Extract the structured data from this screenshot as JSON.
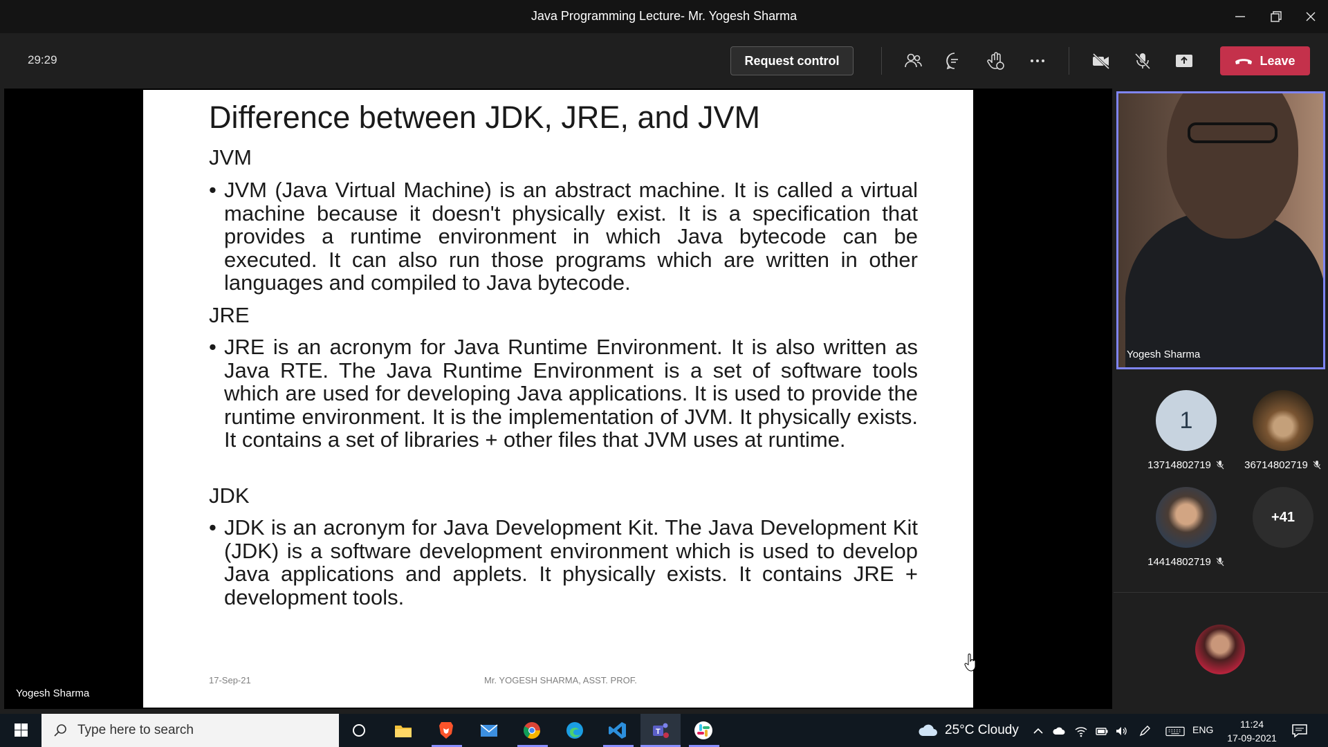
{
  "window": {
    "title": "Java Programming Lecture- Mr. Yogesh Sharma"
  },
  "toolbar": {
    "timer": "29:29",
    "request_control_label": "Request control",
    "leave_label": "Leave",
    "leave_color": "#c4314b"
  },
  "stage": {
    "presenter_name": "Yogesh Sharma"
  },
  "slide": {
    "title": "Difference between JDK, JRE, and JVM",
    "sections": [
      {
        "heading": "JVM",
        "text": "JVM (Java Virtual Machine) is an abstract machine. It is called a virtual machine because it doesn't physically exist. It is a specification that provides a runtime environment in which Java bytecode can be executed. It can also run those programs which are written in other languages and compiled to Java bytecode."
      },
      {
        "heading": "JRE",
        "text": "JRE is an acronym for Java Runtime Environment. It is also written as Java RTE. The Java Runtime Environment is a set of software tools which are used for developing Java applications. It is used to provide the runtime environment. It is the implementation of JVM. It physically exists. It contains a set of libraries + other files that JVM uses at runtime."
      },
      {
        "heading": "JDK",
        "text": "JDK is an acronym for Java Development Kit. The Java Development Kit (JDK) is a software development environment which is used to develop Java applications and applets. It physically exists. It contains JRE + development tools."
      }
    ],
    "footer_date": "17-Sep-21",
    "footer_author": "Mr. YOGESH SHARMA, ASST. PROF.",
    "bullet_char": "•"
  },
  "participants": {
    "featured_name": "Yogesh Sharma",
    "featured_border_color": "#7f85f5",
    "list": [
      {
        "initial": "1",
        "name": "13714802719"
      },
      {
        "name": "36714802719"
      },
      {
        "name": "14414802719"
      }
    ],
    "more_count": "+41"
  },
  "taskbar": {
    "search_placeholder": "Type here to search",
    "weather": "25°C  Cloudy",
    "language": "ENG",
    "time": "11:24",
    "date": "17-09-2021"
  }
}
